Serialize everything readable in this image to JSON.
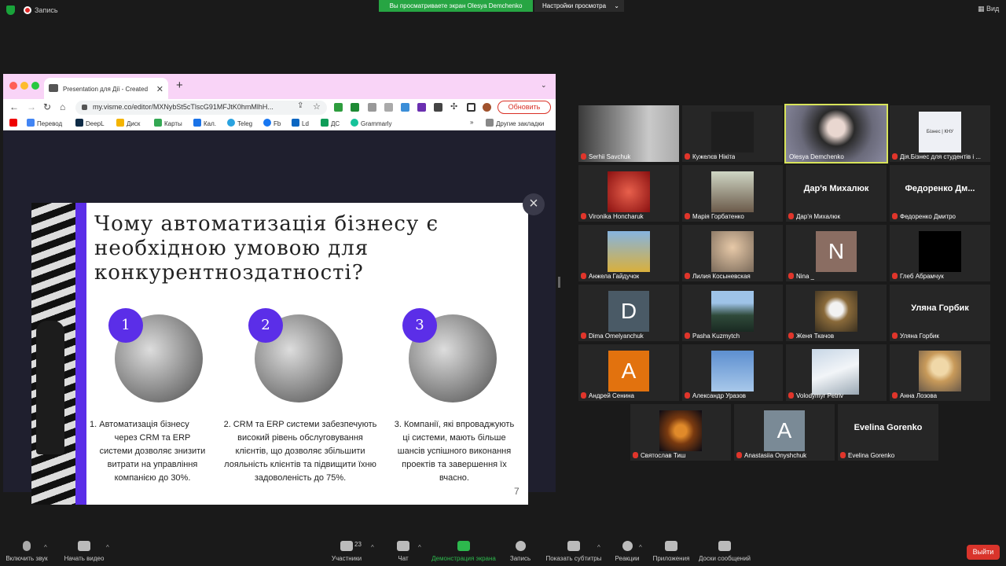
{
  "top_bar": {
    "record_label": "Запись",
    "sharing_banner": "Вы просматриваете экран Olesya Demchenko",
    "view_settings": "Настройки просмотра",
    "view_label": "Вид"
  },
  "browser": {
    "tab_title": "Presentation для Дії - Created",
    "url": "my.visme.co/editor/MXNybSt5cTlscG91MFJtK0hmMlhH...",
    "update_button": "Обновить",
    "bookmarks": [
      "Перевод",
      "DeepL",
      "Диск",
      "Карты",
      "Кал.",
      "Teleg",
      "Fb",
      "Ld",
      "ДС",
      "Grammarly"
    ],
    "bookmarks_more": "»",
    "other_bookmarks": "Другие закладки"
  },
  "slide": {
    "title_lines": [
      "Чому автоматизація бізнесу є",
      "необхідною умовою для",
      "конкурентноздатності?"
    ],
    "columns": [
      {
        "number": "1",
        "lines": [
          "1.     Автоматизація бізнесу",
          "через CRM та ERP",
          "системи дозволяє знизити",
          "витрати на управління",
          "компанією до 30%."
        ]
      },
      {
        "number": "2",
        "lines": [
          "2. CRM та ERP системи забезпечують",
          "високий рівень обслуговування",
          "клієнтів, що дозволяє збільшити",
          "лояльність клієнтів та підвищити їхню",
          "задоволеність до 75%."
        ]
      },
      {
        "number": "3",
        "lines": [
          "3.  Компанії, які впроваджують",
          "ці системи, мають більше",
          "шансів успішного виконання",
          "проектів та завершення їх",
          "вчасно."
        ]
      }
    ],
    "page_number": "7"
  },
  "participants": [
    {
      "name": "Serhii Savchuk"
    },
    {
      "name": "Кужелєв Нікіта"
    },
    {
      "name": "Olesya Demchenko"
    },
    {
      "name": "Дія.Бізнес для студентів і ...",
      "logo_text": "Бізнес | КНУ"
    },
    {
      "name": "Vironika Honcharuk"
    },
    {
      "name": "Марія Горбатенко"
    },
    {
      "name": "Дар'я Михалюк",
      "big": "Дар'я Михалюк"
    },
    {
      "name": "Федоренко Дмитро",
      "big": "Федоренко  Дм..."
    },
    {
      "name": "Анжела Гайдучок"
    },
    {
      "name": "Лилия Косыневская"
    },
    {
      "name": "Nina _",
      "letter": "N"
    },
    {
      "name": "Глеб Абрамчук"
    },
    {
      "name": "Dima Omelyanchuk",
      "letter": "D"
    },
    {
      "name": "Pasha Kuzmytch"
    },
    {
      "name": "Женя Ткачов"
    },
    {
      "name": "Уляна Горбик",
      "big": "Уляна Горбик"
    },
    {
      "name": "Андрей Сенина",
      "letter": "A"
    },
    {
      "name": "Александр Уразов"
    },
    {
      "name": "Volodymyr Petriv"
    },
    {
      "name": "Анна Лозова"
    },
    {
      "name": "Святослав Тиш"
    },
    {
      "name": "Anastasiia Onyshchuk",
      "letter": "A"
    },
    {
      "name": "Evelina Gorenko",
      "big": "Evelina Gorenko"
    }
  ],
  "toolbar": {
    "mute": "Включить звук",
    "video": "Начать видео",
    "participants": "Участники",
    "participants_count": "23",
    "chat": "Чат",
    "share": "Демонстрация экрана",
    "record": "Запись",
    "captions": "Показать субтитры",
    "reactions": "Реакции",
    "apps": "Приложения",
    "whiteboards": "Доски сообщений",
    "leave": "Выйти"
  }
}
